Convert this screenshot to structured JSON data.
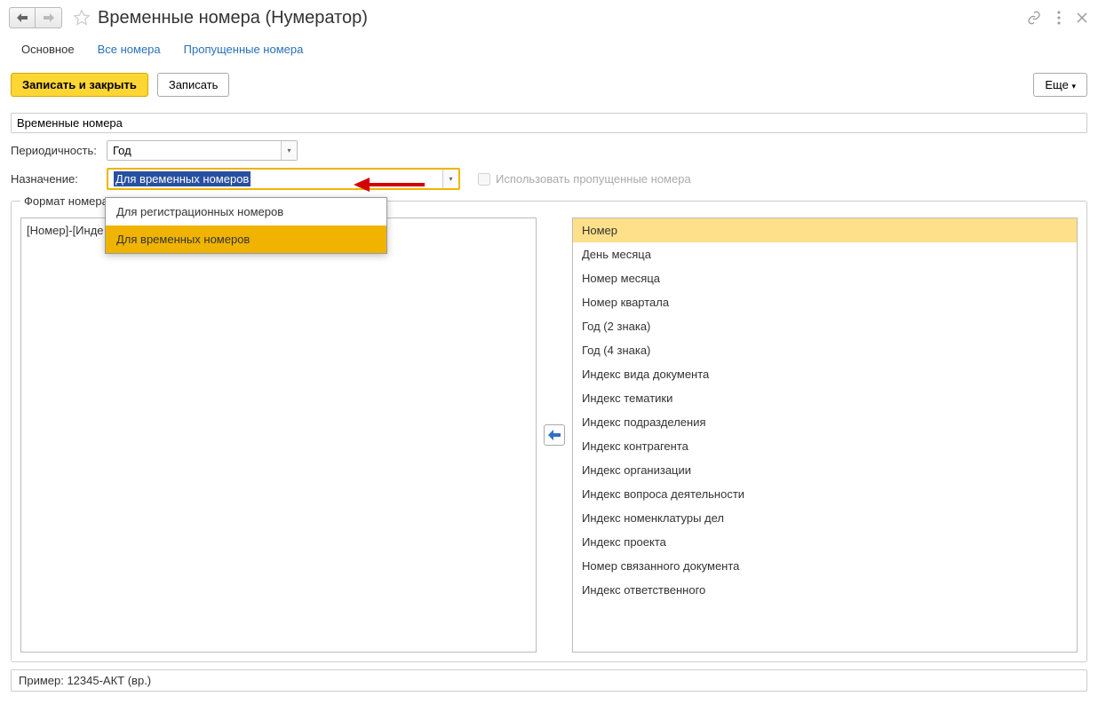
{
  "header": {
    "title": "Временные номера (Нумератор)"
  },
  "tabs": {
    "main": "Основное",
    "all_numbers": "Все номера",
    "skipped": "Пропущенные номера"
  },
  "toolbar": {
    "save_close": "Записать и закрыть",
    "save": "Записать",
    "more": "Еще"
  },
  "fields": {
    "name_value": "Временные номера",
    "periodicity_label": "Периодичность:",
    "periodicity_value": "Год",
    "purpose_label": "Назначение:",
    "purpose_value": "Для временных номеров",
    "use_skipped": "Использовать пропущенные номера"
  },
  "dropdown": {
    "option1": "Для регистрационных номеров",
    "option2": "Для временных номеров"
  },
  "group": {
    "title": "Формат номера"
  },
  "format_text": "[Номер]-[Инде",
  "placeholders": [
    "Номер",
    "День месяца",
    "Номер месяца",
    "Номер квартала",
    "Год (2 знака)",
    "Год (4 знака)",
    "Индекс вида документа",
    "Индекс тематики",
    "Индекс подразделения",
    "Индекс контрагента",
    "Индекс организации",
    "Индекс вопроса деятельности",
    "Индекс номенклатуры дел",
    "Индекс проекта",
    "Номер связанного документа",
    "Индекс ответственного"
  ],
  "example": "Пример: 12345-АКТ (вр.)"
}
